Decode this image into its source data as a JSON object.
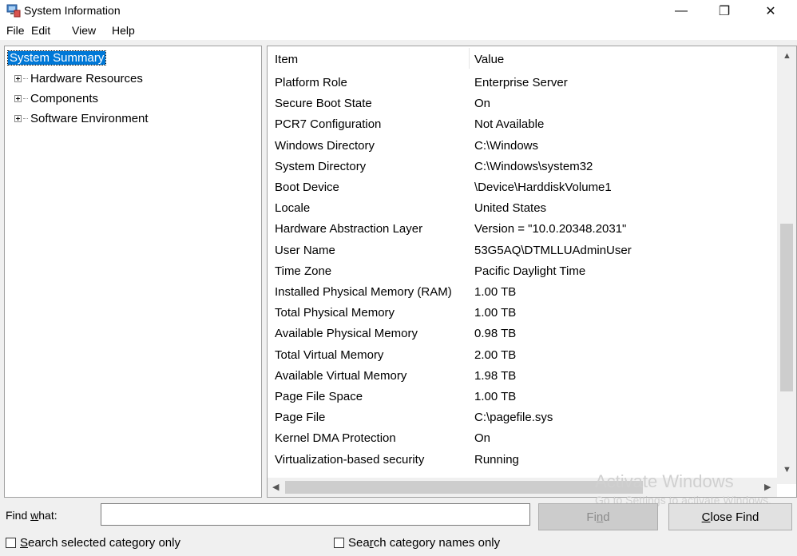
{
  "window": {
    "title": "System Information",
    "minimize_glyph": "—",
    "maximize_glyph": "❐",
    "close_glyph": "✕"
  },
  "menu": [
    "File",
    "Edit",
    "View",
    "Help"
  ],
  "tree": {
    "selected": "System Summary",
    "items": [
      "Hardware Resources",
      "Components",
      "Software Environment"
    ]
  },
  "list": {
    "headers": {
      "item": "Item",
      "value": "Value"
    },
    "rows": [
      {
        "item": "Platform Role",
        "value": "Enterprise Server"
      },
      {
        "item": "Secure Boot State",
        "value": "On"
      },
      {
        "item": "PCR7 Configuration",
        "value": "Not Available"
      },
      {
        "item": "Windows Directory",
        "value": "C:\\Windows"
      },
      {
        "item": "System Directory",
        "value": "C:\\Windows\\system32"
      },
      {
        "item": "Boot Device",
        "value": "\\Device\\HarddiskVolume1"
      },
      {
        "item": "Locale",
        "value": "United States"
      },
      {
        "item": "Hardware Abstraction Layer",
        "value": "Version = \"10.0.20348.2031\""
      },
      {
        "item": "User Name",
        "value": "53G5AQ\\DTMLLUAdminUser"
      },
      {
        "item": "Time Zone",
        "value": "Pacific Daylight Time"
      },
      {
        "item": "Installed Physical Memory (RAM)",
        "value": "1.00 TB"
      },
      {
        "item": "Total Physical Memory",
        "value": "1.00 TB"
      },
      {
        "item": "Available Physical Memory",
        "value": "0.98 TB"
      },
      {
        "item": "Total Virtual Memory",
        "value": "2.00 TB"
      },
      {
        "item": "Available Virtual Memory",
        "value": "1.98 TB"
      },
      {
        "item": "Page File Space",
        "value": "1.00 TB"
      },
      {
        "item": "Page File",
        "value": "C:\\pagefile.sys"
      },
      {
        "item": "Kernel DMA Protection",
        "value": "On"
      },
      {
        "item": "Virtualization-based security",
        "value": "Running"
      }
    ]
  },
  "watermark": {
    "line1": "Activate Windows",
    "line2": "Go to Settings to activate Windows."
  },
  "find": {
    "label_pre": "Find ",
    "label_key": "w",
    "label_post": "hat:",
    "value": "",
    "find_pre": "Fi",
    "find_key": "n",
    "find_post": "d",
    "close_key": "C",
    "close_post": "lose Find",
    "search_selected_key": "S",
    "search_selected_post": "earch selected category only",
    "search_names_pre": "Sea",
    "search_names_key": "r",
    "search_names_post": "ch category names only"
  }
}
